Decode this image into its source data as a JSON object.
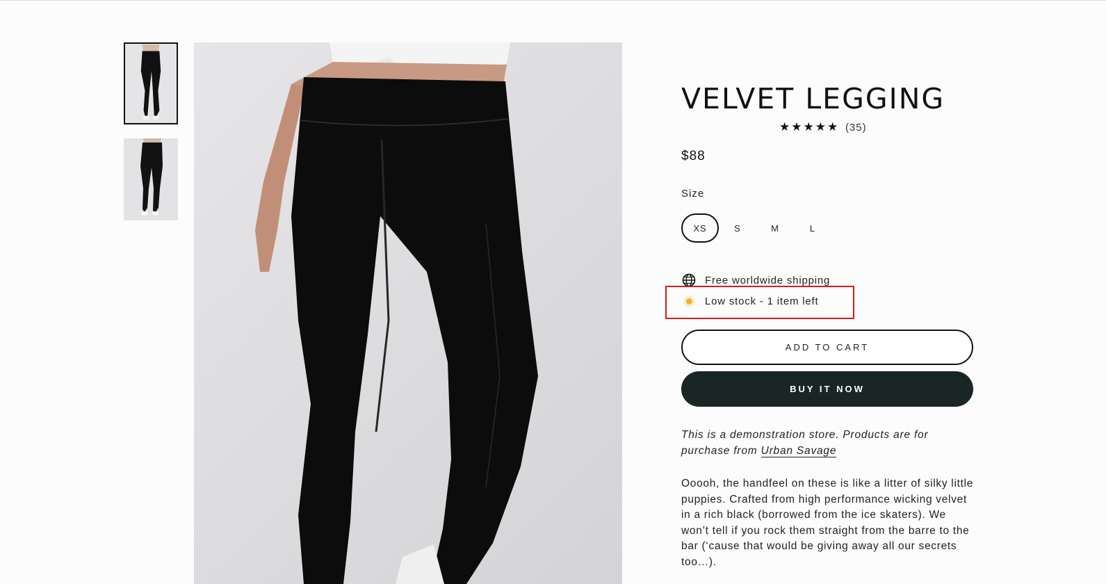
{
  "product": {
    "title": "VELVET LEGGING",
    "rating": {
      "stars": "★★★★★",
      "count": "(35)",
      "value": 5
    },
    "price": "$88",
    "size_label": "Size",
    "sizes": [
      "XS",
      "S",
      "M",
      "L"
    ],
    "selected_size": "XS",
    "features": {
      "shipping": "Free worldwide shipping",
      "stock": "Low stock - 1 item left"
    },
    "buttons": {
      "add_to_cart": "ADD TO CART",
      "buy_now": "BUY IT NOW"
    },
    "demo_note": {
      "text": "This is a demonstration store. Products are for purchase from ",
      "link": "Urban Savage"
    },
    "description": "Ooooh, the handfeel on these is like a litter of silky little puppies. Crafted from high performance wicking velvet in a rich black (borrowed from the ice skaters). We won’t tell if you rock them straight from the barre to the bar (‘cause that would be giving away all our secrets too…)."
  },
  "gallery": {
    "thumbnails": [
      "thumbnail-front",
      "thumbnail-angle"
    ],
    "active_index": 0
  },
  "colors": {
    "stock_indicator": "#f0b429",
    "buy_button": "#1a2526",
    "highlight": "#d01f1f"
  },
  "icons": {
    "shipping": "globe-icon",
    "stock": "stock-dot-icon"
  }
}
